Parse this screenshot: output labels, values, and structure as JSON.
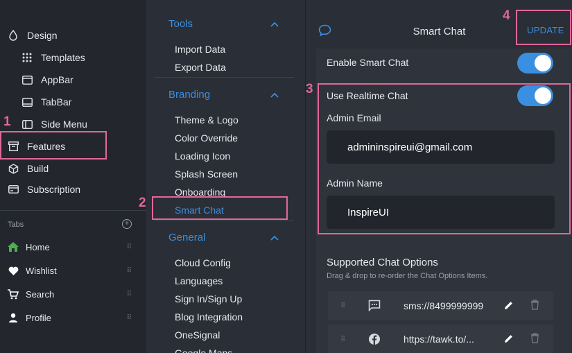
{
  "sidebar": {
    "items": [
      {
        "label": "Design",
        "icon": "design-icon"
      },
      {
        "label": "Templates",
        "icon": "templates-icon"
      },
      {
        "label": "AppBar",
        "icon": "appbar-icon"
      },
      {
        "label": "TabBar",
        "icon": "tabbar-icon"
      },
      {
        "label": "Side Menu",
        "icon": "side-menu-icon"
      },
      {
        "label": "Features",
        "icon": "features-icon"
      },
      {
        "label": "Build",
        "icon": "build-icon"
      },
      {
        "label": "Subscription",
        "icon": "subscription-icon"
      }
    ],
    "tabs_title": "Tabs",
    "tabs": [
      {
        "label": "Home",
        "icon": "home-icon",
        "color": "#4caf50"
      },
      {
        "label": "Wishlist",
        "icon": "heart-icon"
      },
      {
        "label": "Search",
        "icon": "cart-icon"
      },
      {
        "label": "Profile",
        "icon": "person-icon"
      }
    ]
  },
  "middle": {
    "sections": [
      {
        "title": "Tools",
        "items": [
          "Import Data",
          "Export Data"
        ]
      },
      {
        "title": "Branding",
        "items": [
          "Theme & Logo",
          "Color Override",
          "Loading Icon",
          "Splash Screen",
          "Onboarding",
          "Smart Chat"
        ]
      },
      {
        "title": "General",
        "items": [
          "Cloud Config",
          "Languages",
          "Sign In/Sign Up",
          "Blog Integration",
          "OneSignal",
          "Google Maps"
        ]
      }
    ],
    "active_item": "Smart Chat"
  },
  "panel": {
    "title": "Smart Chat",
    "update_label": "UPDATE",
    "enable_label": "Enable Smart Chat",
    "enable_on": true,
    "realtime_label": "Use Realtime Chat",
    "realtime_on": true,
    "admin_email_label": "Admin Email",
    "admin_email_value": "admininspireui@gmail.com",
    "admin_name_label": "Admin Name",
    "admin_name_value": "InspireUI",
    "options_title": "Supported Chat Options",
    "options_subtitle": "Drag & drop to re-order the Chat Options Items.",
    "options": [
      {
        "value": "sms://8499999999",
        "icon": "sms-icon"
      },
      {
        "value": "https://tawk.to/...",
        "icon": "facebook-icon"
      }
    ]
  },
  "annotations": {
    "n1": "1",
    "n2": "2",
    "n3": "3",
    "n4": "4"
  },
  "colors": {
    "accent": "#3b8fe0",
    "highlight": "#e2679a",
    "sidebar_bg": "#23262d",
    "panel_bg": "#2a2e36"
  }
}
